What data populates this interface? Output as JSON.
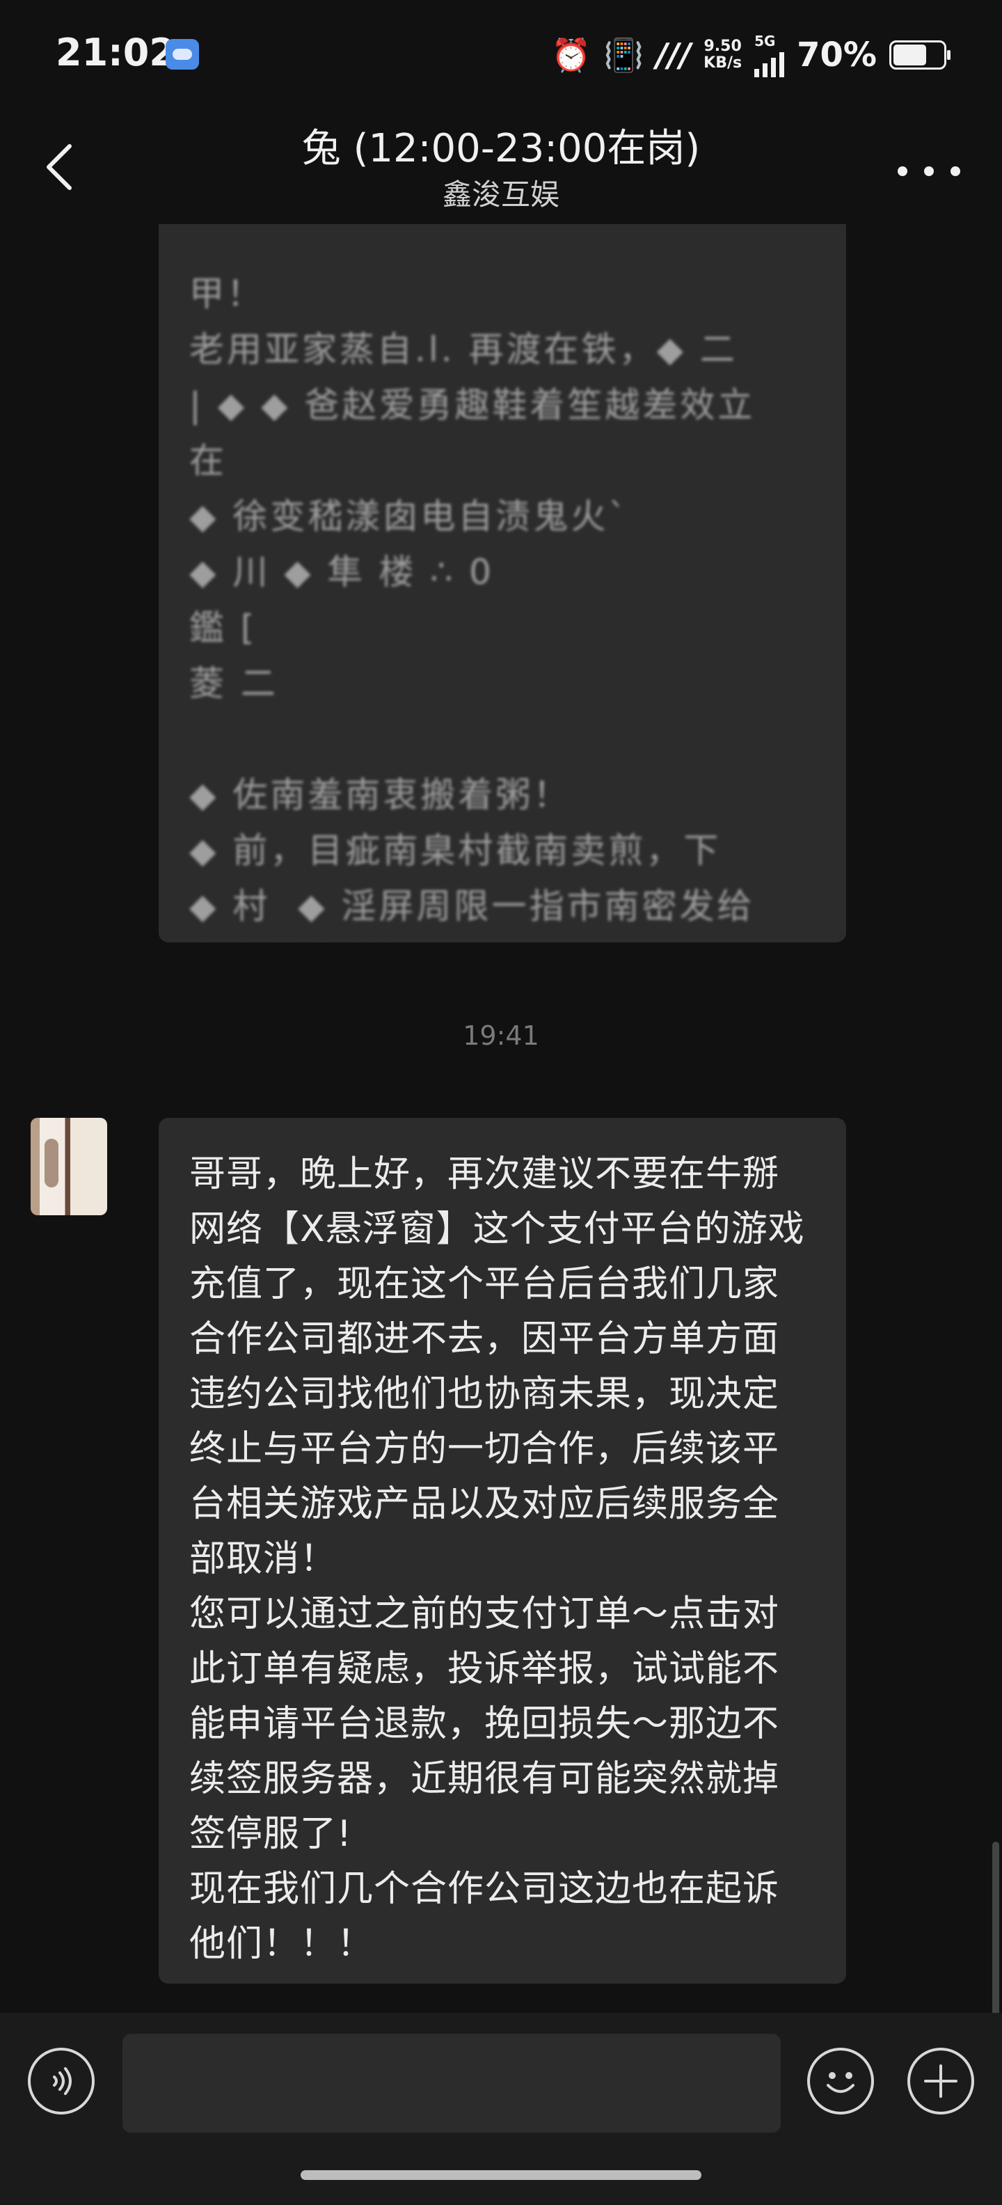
{
  "status_bar": {
    "time": "21:02",
    "net_speed": "9.50",
    "net_speed_unit": "KB/s",
    "network": "5G",
    "battery_percent": "70%",
    "battery_level": 0.7,
    "icons": [
      "notification-app-icon",
      "alarm-icon",
      "vibrate-icon",
      "nfc-icon",
      "signal-icon",
      "battery-icon"
    ]
  },
  "header": {
    "title": "兔 (12:00-23:00在岗)",
    "subtitle": "鑫浚互娱"
  },
  "messages": {
    "top_blurred": "甲！\n老用亚家蒸自.l. 再渡在铁，◆ 二\n| ◆ ◆ 爸赵爱勇趣鞋着笙越差效立\n在\n◆ 徐变嵇漾囱电自渍鬼火ˋ\n◆ 川 ◆ 隼 楼 ∴ 0\n鑑 [\n菱 二\n\n◆ 佐南羞南衷搬着粥！\n◆ 前，目疵南臬村截南卖煎，下\n◆ 村  ◆ 淫屏周限一指市南密发给\n夷安趟薪利留",
    "timestamp": "19:41",
    "main_text": "哥哥，晚上好，再次建议不要在牛掰网络【X悬浮窗】这个支付平台的游戏充值了，现在这个平台后台我们几家合作公司都进不去，因平台方单方面违约公司找他们也协商未果，现决定终止与平台方的一切合作，后续该平台相关游戏产品以及对应后续服务全部取消！\n您可以通过之前的支付订单～点击对此订单有疑虑，投诉举报，试试能不能申请平台退款，挽回损失～那边不续签服务器，近期很有可能突然就掉签停服了!\n现在我们几个合作公司这边也在起诉他们！！！"
  },
  "input": {
    "value": "",
    "placeholder": ""
  }
}
